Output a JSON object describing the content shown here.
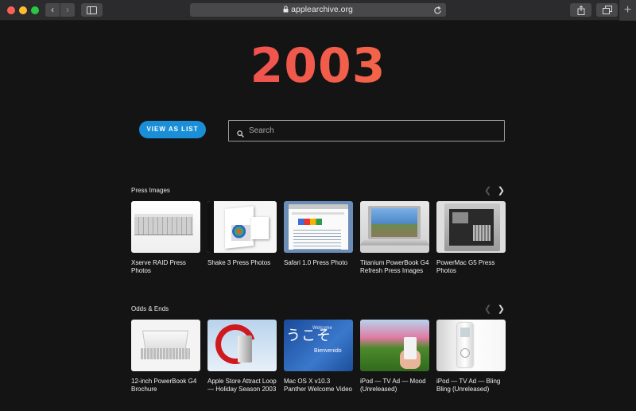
{
  "browser": {
    "url": "applearchive.org",
    "new_tab_symbol": "+"
  },
  "page": {
    "year": "2003",
    "view_as_list": "VIEW AS LIST",
    "search": {
      "placeholder": "Search",
      "value": ""
    }
  },
  "sections": [
    {
      "title": "Press Images",
      "items": [
        {
          "caption": "Xserve RAID Press Photos"
        },
        {
          "caption": "Shake 3 Press Photos"
        },
        {
          "caption": "Safari 1.0 Press Photo"
        },
        {
          "caption": "Titanium PowerBook G4 Refresh Press Images"
        },
        {
          "caption": "PowerMac G5 Press Photos"
        }
      ]
    },
    {
      "title": "Odds & Ends",
      "items": [
        {
          "caption": "12-inch PowerBook G4 Brochure"
        },
        {
          "caption": "Apple Store Attract Loop — Holiday Season 2003"
        },
        {
          "caption": "Mac OS X v10.3 Panther Welcome Video",
          "thumb_text": {
            "jp": "うこそ",
            "en": "Welcome",
            "es": "Bienvenido"
          }
        },
        {
          "caption": "iPod — TV Ad — Mood (Unreleased)"
        },
        {
          "caption": "iPod — TV Ad — Bling Bling (Unreleased)"
        }
      ]
    }
  ],
  "colors": {
    "background": "#141414",
    "accent_button": "#1a8fd8",
    "year_gradient_start": "#ef3f5c",
    "year_gradient_end": "#f7863e"
  },
  "icons": [
    "back-icon",
    "forward-icon",
    "sidebar-icon",
    "lock-icon",
    "reload-icon",
    "share-icon",
    "tabs-icon",
    "search-icon",
    "chevron-left-icon",
    "chevron-right-icon"
  ]
}
